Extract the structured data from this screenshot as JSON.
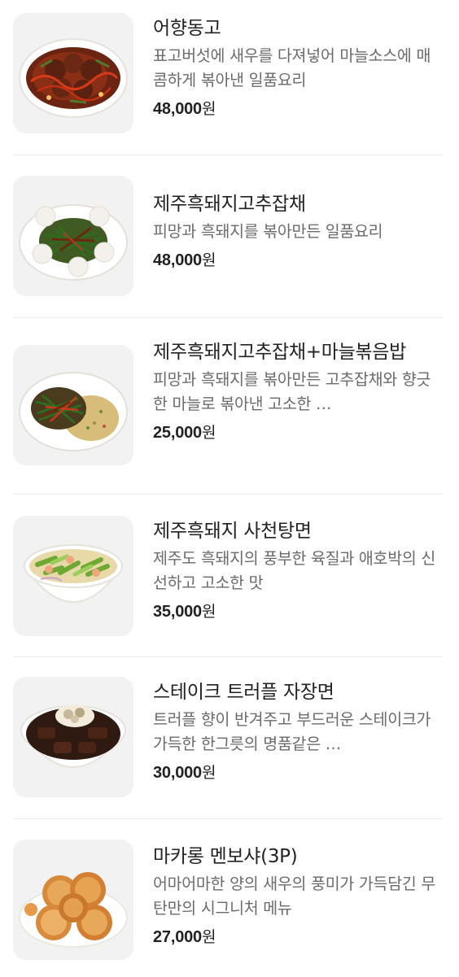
{
  "menu": {
    "items": [
      {
        "name": "어향동고",
        "description": "표고버섯에 새우를 다져넣어 마늘소스에 매콤하게 볶아낸 일품요리",
        "price_number": "48,000",
        "price_unit": "원",
        "image_icon": "eohyang-donggo-dish-icon"
      },
      {
        "name": "제주흑돼지고추잡채",
        "description": "피망과 흑돼지를 볶아만든 일품요리",
        "price_number": "48,000",
        "price_unit": "원",
        "image_icon": "gochu-japchae-dish-icon"
      },
      {
        "name": "제주흑돼지고추잡채+마늘볶음밥",
        "description": "피망과 흑돼지를 볶아만든 고추잡채와 향긋한 마늘로 볶아낸 고소한 …",
        "price_number": "25,000",
        "price_unit": "원",
        "image_icon": "japchae-fried-rice-dish-icon"
      },
      {
        "name": "제주흑돼지 사천탕면",
        "description": "제주도 흑돼지의 풍부한 육질과 애호박의 신선하고 고소한 맛",
        "price_number": "35,000",
        "price_unit": "원",
        "image_icon": "sichuan-noodle-soup-icon"
      },
      {
        "name": "스테이크 트러플 자장면",
        "description": "트러플 향이 반겨주고 부드러운 스테이크가 가득한 한그릇의 명품같은 …",
        "price_number": "30,000",
        "price_unit": "원",
        "image_icon": "truffle-jajangmyeon-icon"
      },
      {
        "name": "마카롱 멘보샤(3P)",
        "description": "어마어마한 양의 새우의 풍미가 가득담긴 무탄만의 시그니처 메뉴",
        "price_number": "27,000",
        "price_unit": "원",
        "image_icon": "macaron-menbosha-icon"
      }
    ]
  },
  "colors": {
    "thumb_bg": "#f2f2f2",
    "divider": "#ececec",
    "name_text": "#222222",
    "desc_text": "#6b6b6b"
  }
}
